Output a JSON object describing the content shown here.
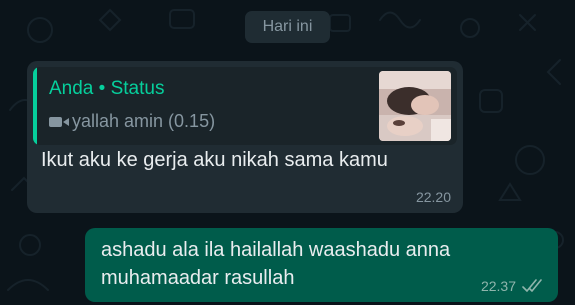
{
  "date_chip": "Hari ini",
  "quoted": {
    "author": "Anda • Status",
    "media_icon": "video-camera-icon",
    "caption": "yallah amin (0.15)"
  },
  "incoming": {
    "text": "Ikut aku ke gerja aku nikah sama kamu",
    "time": "22.20"
  },
  "outgoing": {
    "lines": [
      "ashadu ala ila hailallah waashadu anna",
      "muhamaadar rasullah"
    ],
    "time": "22.37",
    "status_icon": "double-check-read-icon"
  },
  "colors": {
    "background": "#0b141a",
    "incoming_bubble": "#202c33",
    "outgoing_bubble": "#005c4b",
    "accent": "#06cf9c"
  }
}
